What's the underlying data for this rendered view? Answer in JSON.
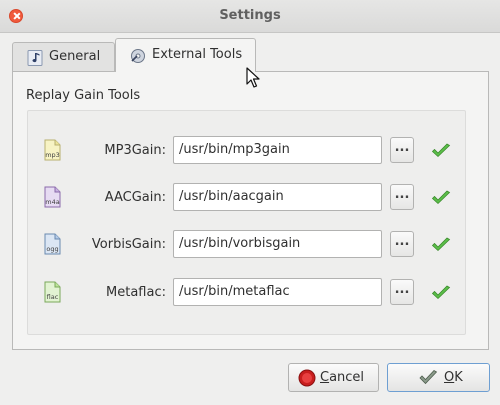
{
  "window": {
    "title": "Settings"
  },
  "tabs": [
    {
      "label": "General",
      "icon": "music-note-icon"
    },
    {
      "label": "External Tools",
      "icon": "tools-disc-icon"
    }
  ],
  "group": {
    "label": "Replay Gain Tools"
  },
  "tools": [
    {
      "icon_text": "mp3",
      "label": "MP3Gain:",
      "path": "/usr/bin/mp3gain",
      "browse": "...",
      "icon_color": "#e8e060"
    },
    {
      "icon_text": "m4a",
      "label": "AACGain:",
      "path": "/usr/bin/aacgain",
      "browse": "...",
      "icon_color": "#a47cc8"
    },
    {
      "icon_text": "ogg",
      "label": "VorbisGain:",
      "path": "/usr/bin/vorbisgain",
      "browse": "...",
      "icon_color": "#7ea6d8"
    },
    {
      "icon_text": "flac",
      "label": "Metaflac:",
      "path": "/usr/bin/metaflac",
      "browse": "...",
      "icon_color": "#9ad46a"
    }
  ],
  "buttons": {
    "cancel": {
      "mnemonic": "C",
      "rest": "ancel"
    },
    "ok": {
      "mnemonic": "O",
      "rest": "K"
    }
  },
  "colors": {
    "check": "#4caf3c",
    "close": "#f05a3c",
    "ok_border": "#6e9fd2"
  }
}
